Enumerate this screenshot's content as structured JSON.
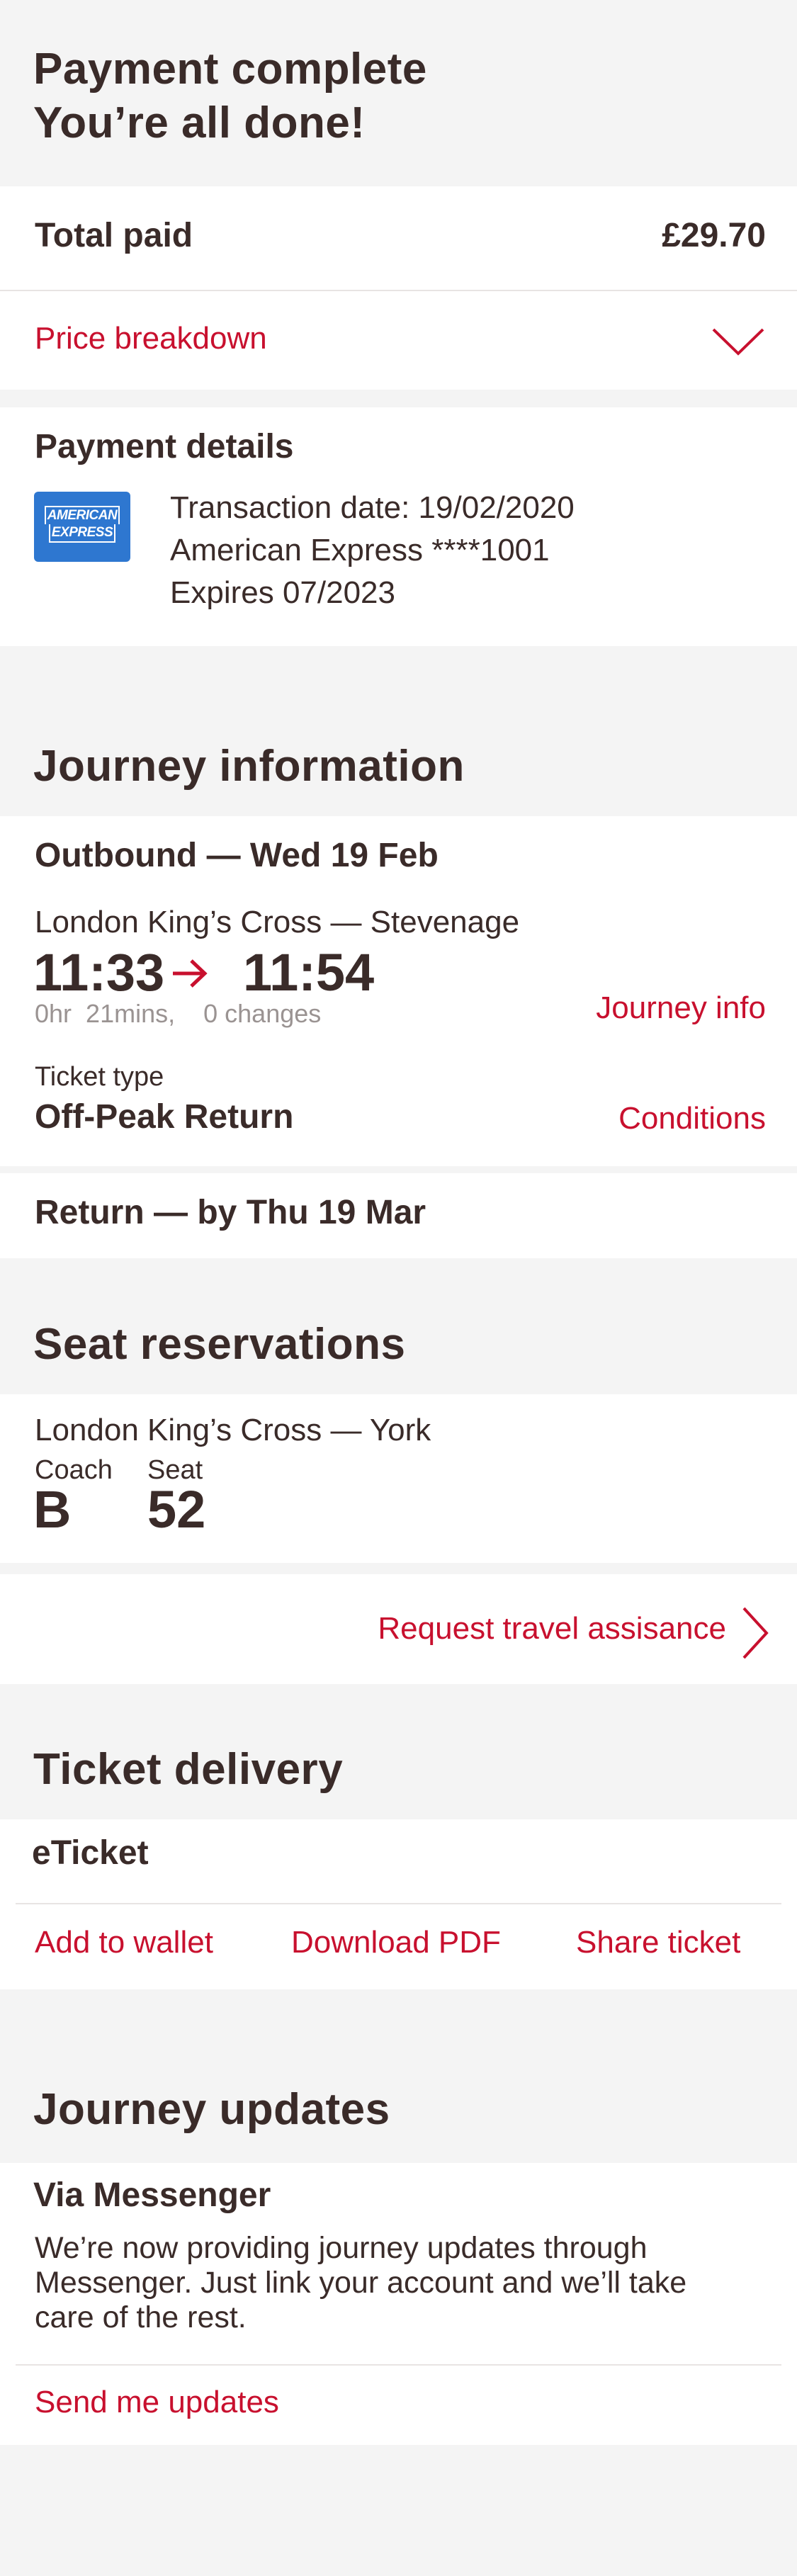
{
  "header": {
    "title_line1": "Payment complete",
    "title_line2": "You’re all done!"
  },
  "total": {
    "label": "Total paid",
    "amount": "£29.70"
  },
  "price_breakdown": {
    "label": "Price breakdown",
    "icon": "chevron-down-icon"
  },
  "payment": {
    "title": "Payment details",
    "card_logo_text_1": "AMERICAN",
    "card_logo_text_2": "EXPRESS",
    "transaction_date": "Transaction date: 19/02/2020",
    "card": "American Express ****1001",
    "expires": "Expires 07/2023"
  },
  "journey": {
    "section_title": "Journey information",
    "outbound_title": "Outbound — Wed 19 Feb",
    "route": "London King’s Cross — Stevenage",
    "depart": "11:33",
    "arrive": "11:54",
    "duration_hr": "0hr",
    "duration_min": "21mins,",
    "changes": "0  changes",
    "journey_info_link": "Journey info",
    "ticket_type_label": "Ticket type",
    "ticket_type": "Off-Peak Return",
    "conditions_link": "Conditions",
    "return_title": "Return — by Thu 19 Mar"
  },
  "seats": {
    "section_title": "Seat reservations",
    "route": "London King’s Cross — York",
    "coach_label": "Coach",
    "coach": "B",
    "seat_label": "Seat",
    "seat": "52",
    "assistance_link": "Request travel assisance"
  },
  "delivery": {
    "section_title": "Ticket delivery",
    "type": "eTicket",
    "actions": [
      "Add to wallet",
      "Download PDF",
      "Share ticket"
    ]
  },
  "updates": {
    "section_title": "Journey updates",
    "via": "Via Messenger",
    "description_line1": "We’re now providing journey updates through",
    "description_line2": "Messenger. Just link your account and we’ll take",
    "description_line3": "care of the rest.",
    "cta": "Send me updates"
  },
  "colors": {
    "accent": "#c8102e",
    "text": "#3a2b29",
    "muted": "#9a9392",
    "background": "#f4f4f4",
    "amex_blue": "#2e77d0"
  }
}
